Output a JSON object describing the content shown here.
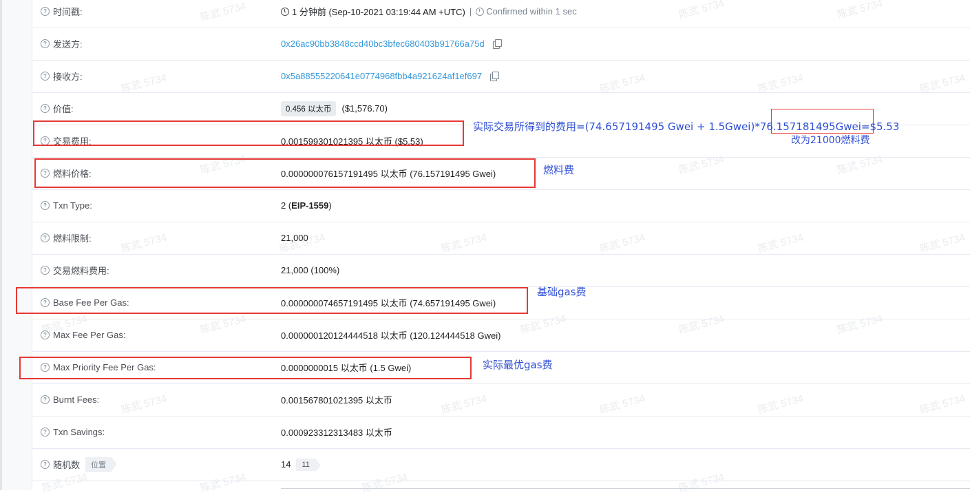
{
  "rows": {
    "timestamp": {
      "label": "时间戳:",
      "time": "1 分钟前 (Sep-10-2021 03:19:44 AM +UTC)",
      "sep": "|",
      "confirmed": "Confirmed within 1 sec"
    },
    "from": {
      "label": "发送方:",
      "address": "0x26ac90bb3848ccd40bc3bfec680403b91766a75d"
    },
    "to": {
      "label": "接收方:",
      "address": "0x5a88555220641e0774968fbb4a921624af1ef697"
    },
    "value": {
      "label": "价值:",
      "amount": "0.456 以太币",
      "usd": "($1,576.70)"
    },
    "tx_fee": {
      "label": "交易费用:",
      "value": "0.001599301021395 以太币 ($5.53)"
    },
    "gas_price": {
      "label": "燃料价格:",
      "value": "0.000000076157191495 以太币 (76.157191495 Gwei)"
    },
    "txn_type": {
      "label": "Txn Type:",
      "prefix": "2 (",
      "bold": "EIP-1559",
      "suffix": ")"
    },
    "gas_limit": {
      "label": "燃料限制:",
      "value": "21,000"
    },
    "gas_used": {
      "label": "交易燃料费用:",
      "value": "21,000 (100%)"
    },
    "base_fee": {
      "label": "Base Fee Per Gas:",
      "value": "0.000000074657191495 以太币 (74.657191495 Gwei)"
    },
    "max_fee": {
      "label": "Max Fee Per Gas:",
      "value": "0.000000120124444518 以太币 (120.124444518 Gwei)"
    },
    "max_priority": {
      "label": "Max Priority Fee Per Gas:",
      "value": "0.0000000015 以太币 (1.5 Gwei)"
    },
    "burnt": {
      "label": "Burnt Fees:",
      "value": "0.001567801021395 以太币"
    },
    "savings": {
      "label": "Txn Savings:",
      "value": "0.000923312313483 以太币"
    },
    "nonce": {
      "label": "随机数",
      "tag": "位置",
      "value": "14",
      "position": "11"
    }
  },
  "annotations": {
    "fee_formula_a": "实际交易所得到的费用=(74.657191495 Gwei + 1.5Gwei)*",
    "fee_formula_b": "76.157181495Gwei",
    "fee_formula_c": "=$5.53",
    "fee_fix": "改为21000燃料费",
    "gas_price": "燃料费",
    "base_fee": "基础gas费",
    "priority_fee": "实际最优gas费"
  },
  "watermark": "陈武 5734",
  "colors": {
    "link": "#3498db",
    "annotation": "#2f4fd4",
    "highlight_box": "#e53935"
  }
}
